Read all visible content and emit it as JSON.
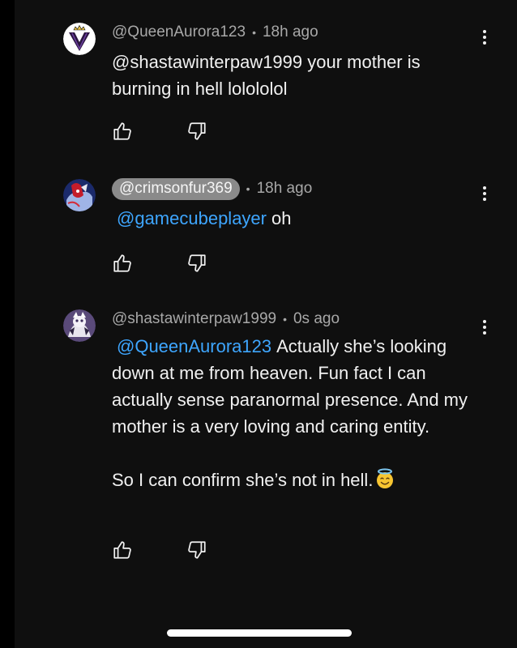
{
  "comments": [
    {
      "author": "@QueenAurora123",
      "time": "18h ago",
      "avatar_icon": "crowned-v-avatar",
      "text": "@shastawinterpaw1999 your mother is burning in hell lolololol"
    },
    {
      "author": "@crimsonfur369",
      "time": "18h ago",
      "avatar_icon": "furry-character-avatar",
      "mention": "@gamecubeplayer",
      "text": "oh"
    },
    {
      "author": "@shastawinterpaw1999",
      "time": "0s ago",
      "avatar_icon": "wolf-character-avatar",
      "mention": "@QueenAurora123",
      "text_p1": "Actually she’s looking down at me from heaven. Fun fact I can actually sense paranormal presence. And my mother is a very loving and caring entity.",
      "text_p2": "So I can confirm she’s not in hell.",
      "emoji": "smiling-face-with-halo"
    }
  ],
  "separator": "•",
  "icons": {
    "like": "thumbs-up-icon",
    "dislike": "thumbs-down-icon",
    "more": "more-vertical-icon"
  },
  "colors": {
    "background": "#0f0f0f",
    "text": "#f1f1f1",
    "meta": "#a8a8a8",
    "mention": "#3ea6ff",
    "pill": "#8a8a8a"
  }
}
